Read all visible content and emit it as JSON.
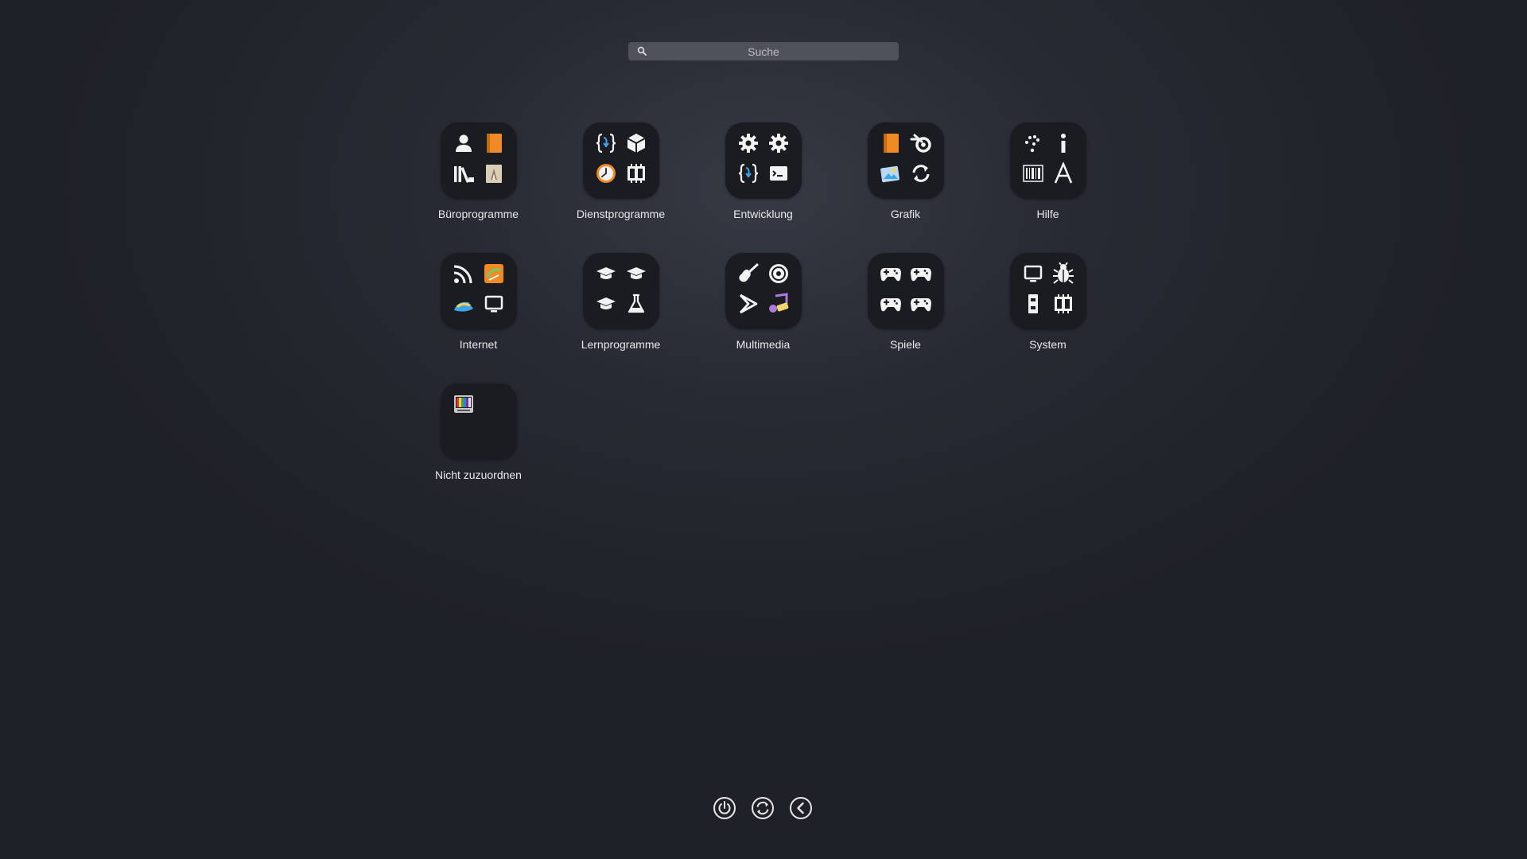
{
  "search": {
    "placeholder": "Suche",
    "value": ""
  },
  "categories": [
    {
      "label": "Büroprogramme"
    },
    {
      "label": "Dienstprogramme"
    },
    {
      "label": "Entwicklung"
    },
    {
      "label": "Grafik"
    },
    {
      "label": "Hilfe"
    },
    {
      "label": "Internet"
    },
    {
      "label": "Lernprogramme"
    },
    {
      "label": "Multimedia"
    },
    {
      "label": "Spiele"
    },
    {
      "label": "System"
    },
    {
      "label": "Nicht zuzuordnen"
    }
  ],
  "bottom_bar": {
    "icons": [
      "power-icon",
      "refresh-icon",
      "back-icon"
    ]
  },
  "colors": {
    "accent_orange": "#f08a24",
    "accent_blue": "#3ea6e8",
    "icon_white": "#f2f2f2",
    "tile_bg": "#1a1c22"
  }
}
